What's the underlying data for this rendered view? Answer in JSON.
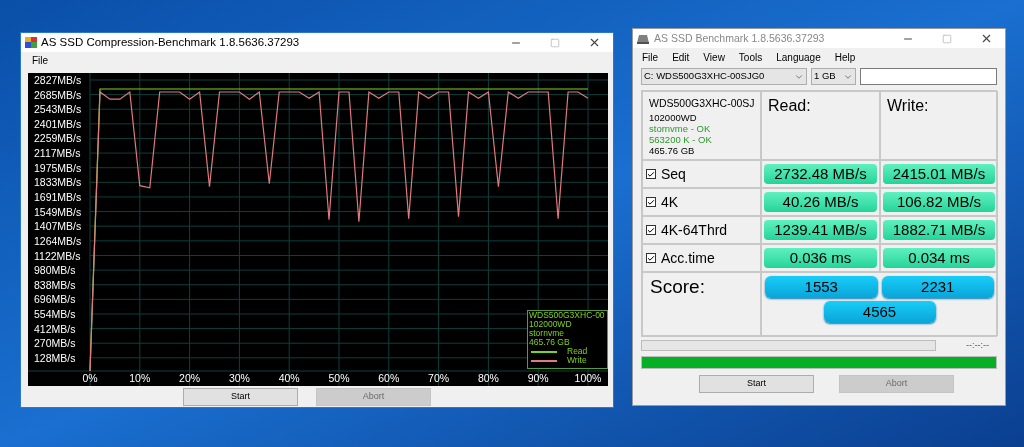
{
  "compression_window": {
    "title": "AS SSD Compression-Benchmark 1.8.5636.37293",
    "menu": [
      "File"
    ],
    "chart": {
      "chart_data": {
        "type": "line",
        "x": [
          0,
          2,
          4,
          6,
          8,
          10,
          12,
          14,
          16,
          18,
          20,
          22,
          24,
          26,
          28,
          30,
          32,
          34,
          36,
          38,
          40,
          42,
          44,
          46,
          48,
          50,
          52,
          54,
          56,
          58,
          60,
          62,
          64,
          66,
          68,
          70,
          72,
          74,
          76,
          78,
          80,
          82,
          84,
          86,
          88,
          90,
          92,
          94,
          96,
          98,
          100
        ],
        "series": [
          {
            "name": "Read",
            "color": "#7ed321",
            "values": [
              0,
              2740,
              2740,
              2740,
              2740,
              2740,
              2740,
              2740,
              2740,
              2740,
              2740,
              2740,
              2740,
              2740,
              2740,
              2740,
              2740,
              2740,
              2740,
              2740,
              2740,
              2740,
              2740,
              2740,
              2740,
              2740,
              2740,
              2740,
              2740,
              2740,
              2740,
              2740,
              2740,
              2740,
              2740,
              2740,
              2740,
              2740,
              2740,
              2740,
              2740,
              2740,
              2740,
              2740,
              2740,
              2740,
              2740,
              2740,
              2740,
              2740,
              2740
            ]
          },
          {
            "name": "Write",
            "color": "#e07a80",
            "values": [
              0,
              2710,
              2640,
              2640,
              2710,
              1800,
              1780,
              2710,
              2710,
              2710,
              2640,
              2710,
              1790,
              2710,
              2710,
              2710,
              2640,
              2710,
              1820,
              2710,
              2710,
              2710,
              2650,
              2710,
              1470,
              2710,
              2710,
              1450,
              2710,
              2650,
              2710,
              2710,
              1480,
              2710,
              2650,
              2710,
              2710,
              1500,
              2710,
              2650,
              2710,
              1790,
              2710,
              2650,
              2710,
              2710,
              2710,
              1480,
              2710,
              2710,
              2650
            ]
          }
        ],
        "ylim": [
          0,
          2827
        ],
        "yticks": [
          {
            "value": 2827,
            "label": "2827MB/s"
          },
          {
            "value": 2685,
            "label": "2685MB/s"
          },
          {
            "value": 2543,
            "label": "2543MB/s"
          },
          {
            "value": 2401,
            "label": "2401MB/s"
          },
          {
            "value": 2259,
            "label": "2259MB/s"
          },
          {
            "value": 2117,
            "label": "2117MB/s"
          },
          {
            "value": 1975,
            "label": "1975MB/s"
          },
          {
            "value": 1833,
            "label": "1833MB/s"
          },
          {
            "value": 1691,
            "label": "1691MB/s"
          },
          {
            "value": 1549,
            "label": "1549MB/s"
          },
          {
            "value": 1407,
            "label": "1407MB/s"
          },
          {
            "value": 1264,
            "label": "1264MB/s"
          },
          {
            "value": 1122,
            "label": "1122MB/s"
          },
          {
            "value": 980,
            "label": "980MB/s"
          },
          {
            "value": 838,
            "label": "838MB/s"
          },
          {
            "value": 696,
            "label": "696MB/s"
          },
          {
            "value": 554,
            "label": "554MB/s"
          },
          {
            "value": 412,
            "label": "412MB/s"
          },
          {
            "value": 270,
            "label": "270MB/s"
          },
          {
            "value": 128,
            "label": "128MB/s"
          }
        ],
        "xlim": [
          0,
          100
        ],
        "grid": true,
        "xticks": [
          {
            "value": 0,
            "label": "0%"
          },
          {
            "value": 10,
            "label": "10%"
          },
          {
            "value": 20,
            "label": "20%"
          },
          {
            "value": 30,
            "label": "30%"
          },
          {
            "value": 40,
            "label": "40%"
          },
          {
            "value": 50,
            "label": "50%"
          },
          {
            "value": 60,
            "label": "60%"
          },
          {
            "value": 70,
            "label": "70%"
          },
          {
            "value": 80,
            "label": "80%"
          },
          {
            "value": 90,
            "label": "90%"
          },
          {
            "value": 100,
            "label": "100%"
          }
        ]
      },
      "legend_info": [
        "WDS500G3XHC-00",
        "102000WD",
        "stornvme",
        "465.76 GB"
      ]
    },
    "buttons": [
      {
        "label": "Start",
        "disabled": false
      },
      {
        "label": "Abort",
        "disabled": true
      }
    ]
  },
  "benchmark_window": {
    "title": "AS SSD Benchmark 1.8.5636.37293",
    "menu": [
      "File",
      "Edit",
      "View",
      "Tools",
      "Language",
      "Help"
    ],
    "drive": "C: WDS500G3XHC-00SJG0",
    "size": "1 GB",
    "info": [
      {
        "text": "WDS500G3XHC-00SJ",
        "kind": "name"
      },
      {
        "text": "102000WD",
        "kind": "plain"
      },
      {
        "text": "stornvme - OK",
        "kind": "ok"
      },
      {
        "text": "563200 K - OK",
        "kind": "ok"
      },
      {
        "text": "465.76 GB",
        "kind": "plain"
      }
    ],
    "columns": [
      "Read:",
      "Write:"
    ],
    "rows": [
      {
        "label": "Seq",
        "checked": true,
        "read": "2732.48 MB/s",
        "write": "2415.01 MB/s"
      },
      {
        "label": "4K",
        "checked": true,
        "read": "40.26 MB/s",
        "write": "106.82 MB/s"
      },
      {
        "label": "4K-64Thrd",
        "checked": true,
        "read": "1239.41 MB/s",
        "write": "1882.71 MB/s"
      },
      {
        "label": "Acc.time",
        "checked": true,
        "read": "0.036 ms",
        "write": "0.034 ms"
      }
    ],
    "score": {
      "label": "Score:",
      "read": "1553",
      "write": "2231",
      "total": "4565"
    },
    "progress": {
      "level": 0,
      "time": "--:--:--"
    },
    "total_progress": {
      "level": 1
    },
    "buttons": [
      {
        "label": "Start",
        "disabled": false
      },
      {
        "label": "Abort",
        "disabled": true
      }
    ]
  }
}
